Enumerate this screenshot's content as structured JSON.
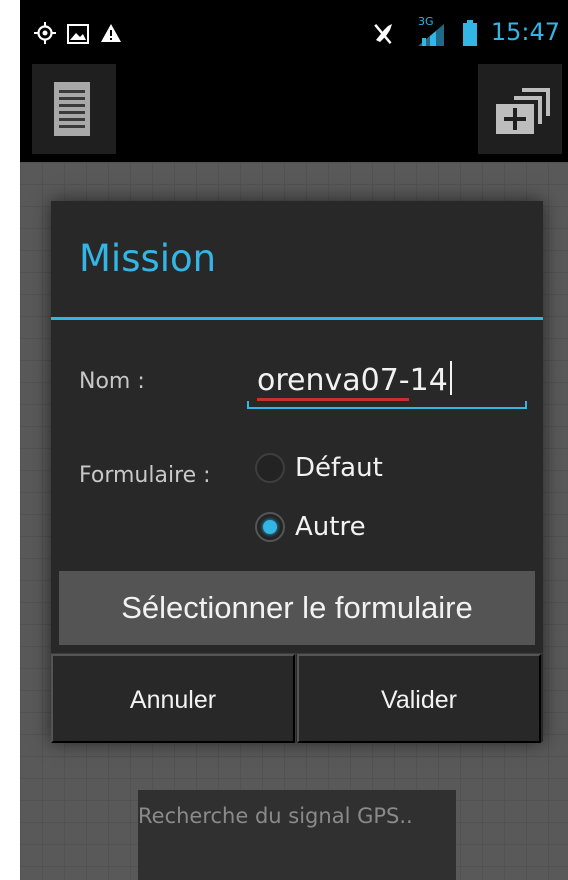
{
  "status_bar": {
    "time": "15:47",
    "network": "3G",
    "icons": [
      "gps-icon",
      "image-icon",
      "warning-icon",
      "mute-icon",
      "signal-icon",
      "battery-icon"
    ]
  },
  "action_bar": {
    "left_icon": "list-icon",
    "right_icon": "add-window-icon"
  },
  "dialog": {
    "title": "Mission",
    "name_label": "Nom :",
    "name_value": "orenva07-14",
    "form_label": "Formulaire :",
    "options": [
      {
        "label": "Défaut",
        "checked": false
      },
      {
        "label": "Autre",
        "checked": true
      }
    ],
    "select_button": "Sélectionner le formulaire",
    "cancel_button": "Annuler",
    "confirm_button": "Valider"
  },
  "map": {
    "gps_status": "Recherche du signal GPS.."
  },
  "colors": {
    "accent": "#33b5e5",
    "dialog_bg": "#282828",
    "map_bg": "#595959"
  }
}
